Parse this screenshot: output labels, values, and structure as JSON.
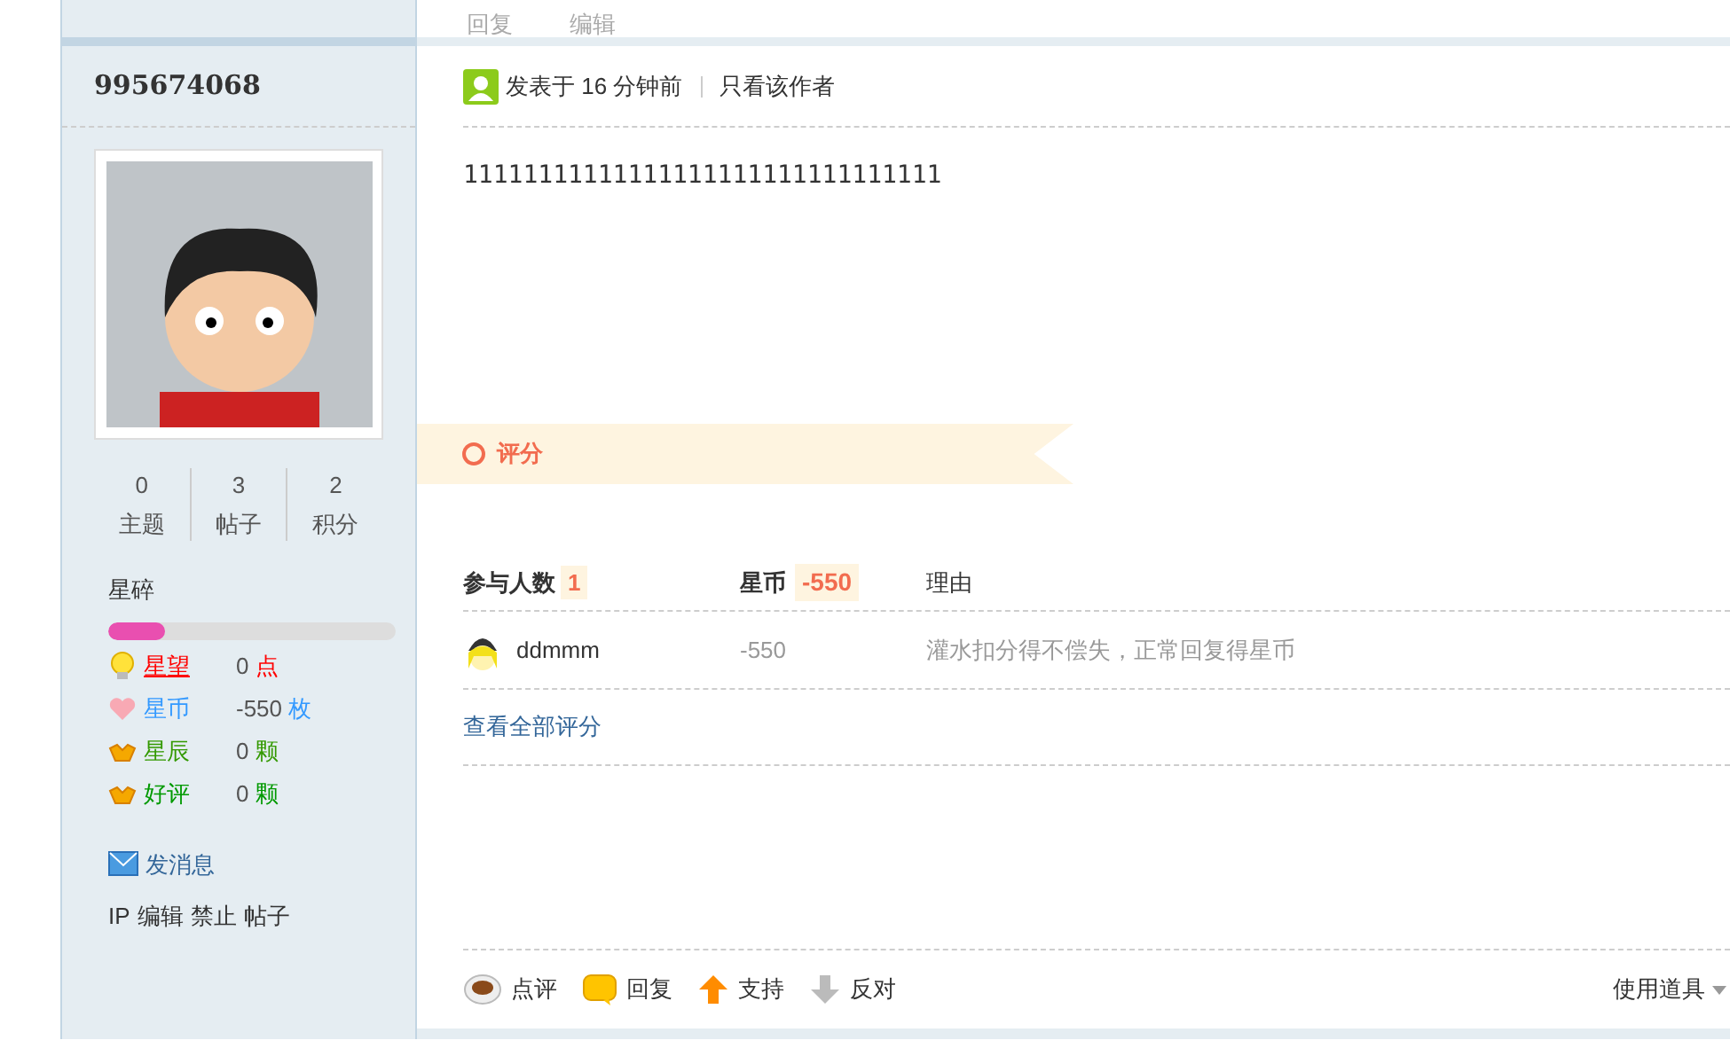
{
  "previous_post_actions": [
    "回复",
    "编辑"
  ],
  "author": {
    "name": "995674068",
    "stats": [
      {
        "value": "0",
        "label": "主题"
      },
      {
        "value": "3",
        "label": "帖子"
      },
      {
        "value": "2",
        "label": "积分"
      }
    ],
    "rank": "星碎",
    "rank_progress": {
      "level": 0.2
    },
    "credits": [
      {
        "kind": "bulb",
        "label": "星望",
        "value": "0",
        "unit": "点",
        "color": "#ff0000"
      },
      {
        "kind": "heart",
        "label": "星币",
        "value": "-550",
        "unit": "枚",
        "color": "#3399ff"
      },
      {
        "kind": "ingot",
        "label": "星辰",
        "value": "0",
        "unit": "颗",
        "color": "#339900"
      },
      {
        "kind": "ingot",
        "label": "好评",
        "value": "0",
        "unit": "颗",
        "color": "#009900"
      }
    ],
    "message_link": "发消息",
    "admin_links": [
      "IP",
      "编辑",
      "禁止",
      "帖子"
    ]
  },
  "post": {
    "posted": "发表于 16 分钟前",
    "only_author": "只看该作者",
    "body": "11111111111111111111111111111111",
    "rating": {
      "title": "评分",
      "participants_label": "参与人数",
      "participants": "1",
      "coin_label": "星币",
      "coin_total": "-550",
      "reason_label": "理由",
      "rows": [
        {
          "user": "ddmmm",
          "coin": "-550",
          "reason": "灌水扣分得不偿失，正常回复得星币"
        }
      ],
      "view_all": "查看全部评分"
    },
    "actions": [
      {
        "kind": "comment",
        "label": "点评"
      },
      {
        "kind": "reply",
        "label": "回复"
      },
      {
        "kind": "support",
        "label": "支持"
      },
      {
        "kind": "oppose",
        "label": "反对"
      }
    ],
    "tools": "使用道具"
  }
}
